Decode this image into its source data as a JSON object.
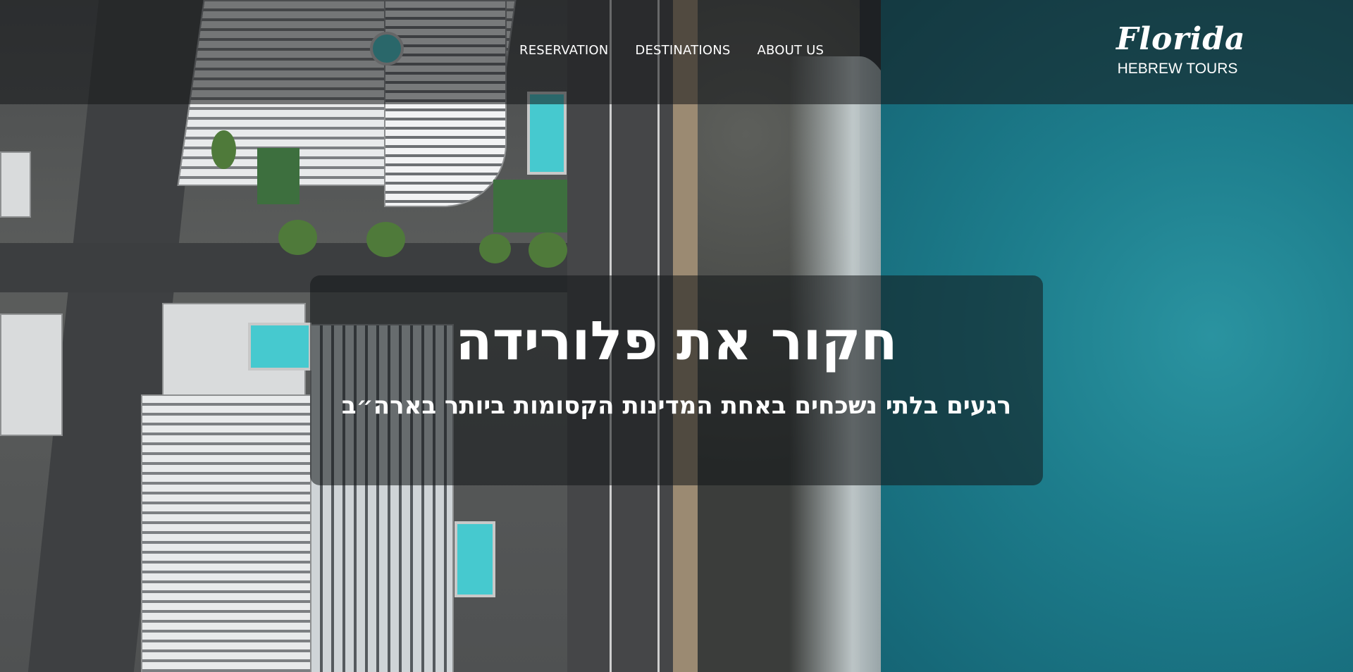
{
  "nav": {
    "items": [
      {
        "label": "RESERVATION"
      },
      {
        "label": "DESTINATIONS"
      },
      {
        "label": "ABOUT US"
      }
    ]
  },
  "logo": {
    "script": "Florida",
    "subtitle": "HEBREW TOURS"
  },
  "hero": {
    "title": "חקור את פלורידה",
    "subtitle": "רגעים בלתי נשכחים באחת המדינות הקסומות ביותר בארה״ב"
  },
  "colors": {
    "header_overlay": "#141618",
    "panel_overlay": "#121618",
    "text": "#ffffff",
    "sea": "#1d7d8c"
  }
}
